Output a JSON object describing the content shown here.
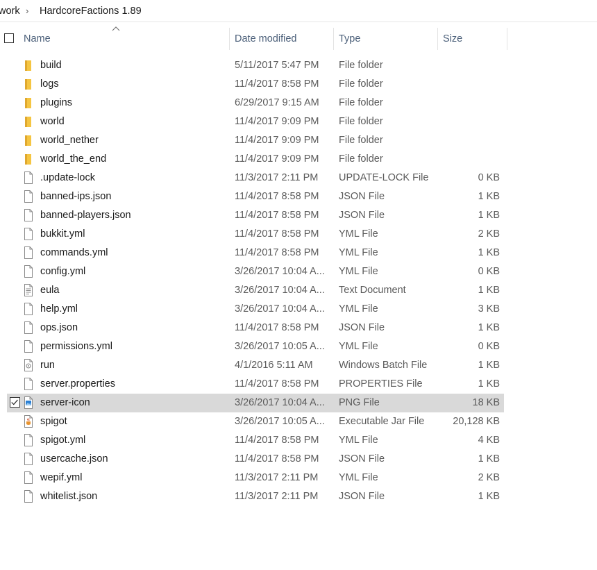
{
  "breadcrumb": {
    "parent": "work",
    "separator": "›",
    "current": "HardcoreFactions 1.89"
  },
  "columns": {
    "name": "Name",
    "date": "Date modified",
    "type": "Type",
    "size": "Size"
  },
  "icons": {
    "folder": "folder-icon",
    "file": "file-icon",
    "text": "text-document-icon",
    "batch": "batch-file-icon",
    "image": "image-file-icon",
    "jar": "jar-file-icon",
    "checkbox": "checkbox"
  },
  "colors": {
    "folder": "#f5c542",
    "selection": "#d9d9d9",
    "header_text": "#4c607a"
  },
  "files": [
    {
      "name": "build",
      "date": "5/11/2017 5:47 PM",
      "type": "File folder",
      "size": "",
      "icon": "folder"
    },
    {
      "name": "logs",
      "date": "11/4/2017 8:58 PM",
      "type": "File folder",
      "size": "",
      "icon": "folder"
    },
    {
      "name": "plugins",
      "date": "6/29/2017 9:15 AM",
      "type": "File folder",
      "size": "",
      "icon": "folder"
    },
    {
      "name": "world",
      "date": "11/4/2017 9:09 PM",
      "type": "File folder",
      "size": "",
      "icon": "folder"
    },
    {
      "name": "world_nether",
      "date": "11/4/2017 9:09 PM",
      "type": "File folder",
      "size": "",
      "icon": "folder"
    },
    {
      "name": "world_the_end",
      "date": "11/4/2017 9:09 PM",
      "type": "File folder",
      "size": "",
      "icon": "folder"
    },
    {
      "name": ".update-lock",
      "date": "11/3/2017 2:11 PM",
      "type": "UPDATE-LOCK File",
      "size": "0 KB",
      "icon": "file"
    },
    {
      "name": "banned-ips.json",
      "date": "11/4/2017 8:58 PM",
      "type": "JSON File",
      "size": "1 KB",
      "icon": "file"
    },
    {
      "name": "banned-players.json",
      "date": "11/4/2017 8:58 PM",
      "type": "JSON File",
      "size": "1 KB",
      "icon": "file"
    },
    {
      "name": "bukkit.yml",
      "date": "11/4/2017 8:58 PM",
      "type": "YML File",
      "size": "2 KB",
      "icon": "file"
    },
    {
      "name": "commands.yml",
      "date": "11/4/2017 8:58 PM",
      "type": "YML File",
      "size": "1 KB",
      "icon": "file"
    },
    {
      "name": "config.yml",
      "date": "3/26/2017 10:04 A...",
      "type": "YML File",
      "size": "0 KB",
      "icon": "file"
    },
    {
      "name": "eula",
      "date": "3/26/2017 10:04 A...",
      "type": "Text Document",
      "size": "1 KB",
      "icon": "text"
    },
    {
      "name": "help.yml",
      "date": "3/26/2017 10:04 A...",
      "type": "YML File",
      "size": "3 KB",
      "icon": "file"
    },
    {
      "name": "ops.json",
      "date": "11/4/2017 8:58 PM",
      "type": "JSON File",
      "size": "1 KB",
      "icon": "file"
    },
    {
      "name": "permissions.yml",
      "date": "3/26/2017 10:05 A...",
      "type": "YML File",
      "size": "0 KB",
      "icon": "file"
    },
    {
      "name": "run",
      "date": "4/1/2016 5:11 AM",
      "type": "Windows Batch File",
      "size": "1 KB",
      "icon": "batch"
    },
    {
      "name": "server.properties",
      "date": "11/4/2017 8:58 PM",
      "type": "PROPERTIES File",
      "size": "1 KB",
      "icon": "file"
    },
    {
      "name": "server-icon",
      "date": "3/26/2017 10:04 A...",
      "type": "PNG File",
      "size": "18 KB",
      "icon": "image",
      "selected": true
    },
    {
      "name": "spigot",
      "date": "3/26/2017 10:05 A...",
      "type": "Executable Jar File",
      "size": "20,128 KB",
      "icon": "jar"
    },
    {
      "name": "spigot.yml",
      "date": "11/4/2017 8:58 PM",
      "type": "YML File",
      "size": "4 KB",
      "icon": "file"
    },
    {
      "name": "usercache.json",
      "date": "11/4/2017 8:58 PM",
      "type": "JSON File",
      "size": "1 KB",
      "icon": "file"
    },
    {
      "name": "wepif.yml",
      "date": "11/3/2017 2:11 PM",
      "type": "YML File",
      "size": "2 KB",
      "icon": "file"
    },
    {
      "name": "whitelist.json",
      "date": "11/3/2017 2:11 PM",
      "type": "JSON File",
      "size": "1 KB",
      "icon": "file"
    }
  ]
}
